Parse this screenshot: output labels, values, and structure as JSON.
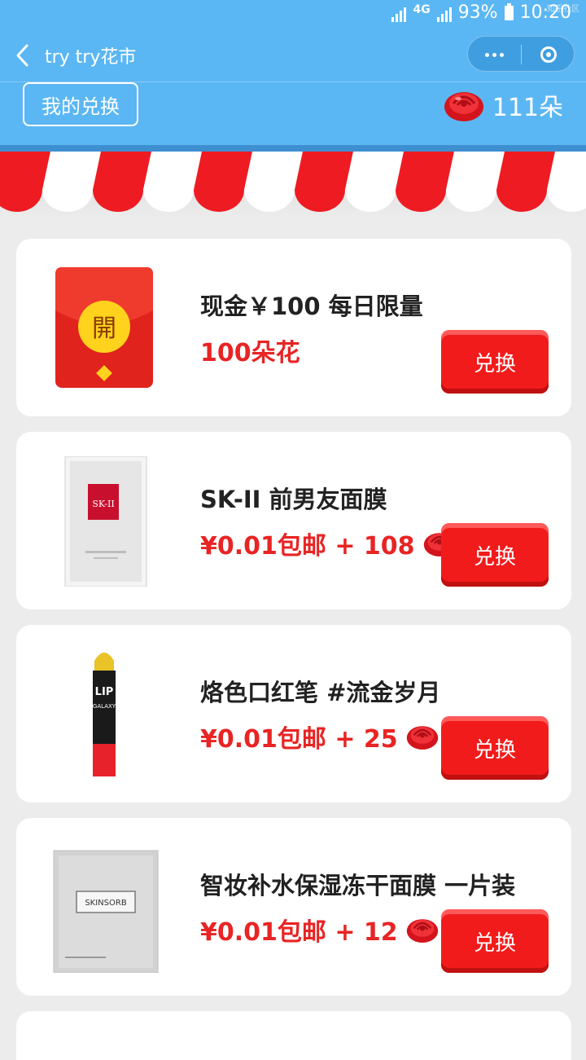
{
  "status_bar": {
    "network": "4G",
    "battery": "93%",
    "time": "10:20",
    "watermark": "知乎社区"
  },
  "nav": {
    "title": "try try花市"
  },
  "header": {
    "my_exchange_label": "我的兑换",
    "flower_count": "111朵"
  },
  "products": [
    {
      "name": "现金￥100 每日限量",
      "price": "100朵花",
      "show_flower": false,
      "button": "兑换",
      "image": "red-envelope"
    },
    {
      "name": "SK-II 前男友面膜",
      "price": "¥0.01包邮 + 108",
      "show_flower": true,
      "button": "兑换",
      "image": "facial-mask"
    },
    {
      "name": "烙色口红笔 #流金岁月",
      "price": "¥0.01包邮 + 25",
      "show_flower": true,
      "button": "兑换",
      "image": "lipstick"
    },
    {
      "name": "智妆补水保湿冻干面膜 一片装",
      "price": "¥0.01包邮 + 12",
      "show_flower": true,
      "button": "兑换",
      "image": "mask-pack"
    }
  ],
  "images": {
    "envelope_char": "開",
    "skii_logo": "SK-II",
    "lip_brand": "LIP",
    "lip_sub": "GALAXY",
    "skinsorb": "SKINSORB"
  },
  "colors": {
    "header_blue": "#5bb7f3",
    "price_red": "#e82424",
    "button_red": "#f21b1b"
  }
}
